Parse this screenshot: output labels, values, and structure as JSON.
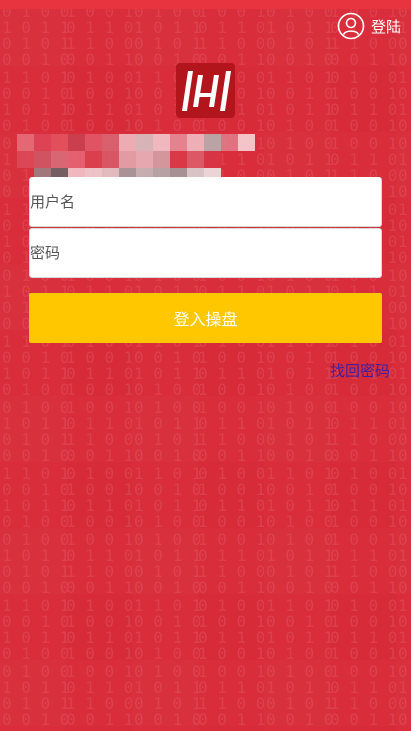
{
  "header": {
    "login_label": "登陆"
  },
  "form": {
    "username_placeholder": "用户名",
    "password_placeholder": "密码",
    "submit_label": "登入操盘",
    "forgot_password_label": "找回密码"
  },
  "colors": {
    "background": "#d92d3b",
    "button": "#ffc700",
    "link": "#3a1fa8"
  },
  "icons": {
    "user": "user-icon",
    "logo": "brand-logo"
  }
}
